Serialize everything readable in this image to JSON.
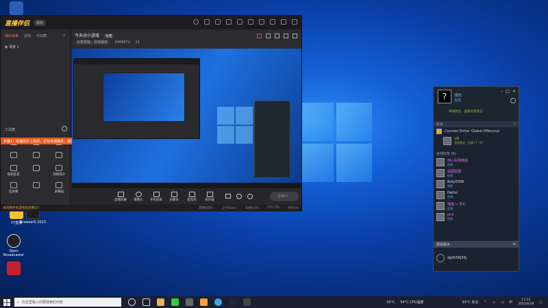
{
  "desktop": {
    "icons": [
      {
        "label": "YY直播",
        "color": "#f2c230"
      },
      {
        "label": "BrowserS 2023",
        "color": "#1e1e1e"
      },
      {
        "label": "Open Broadcaster",
        "color": "#222"
      },
      {
        "label": "",
        "color": "#c8202e"
      }
    ]
  },
  "app": {
    "brand": "直播伴侣",
    "version": "版权",
    "user_id": "6468872",
    "left_tabs": [
      "我的场景",
      "剪辑",
      "可收藏"
    ],
    "scene_label": "场景 1",
    "tools_title": "工具箱",
    "tools": [
      "",
      "",
      "",
      "",
      "",
      "",
      "",
      "",
      "",
      "",
      "",
      ""
    ],
    "tool_labels": [
      "",
      "",
      "",
      "",
      "",
      "",
      "视频连麦",
      "",
      "网络观众",
      "连屏幕",
      "",
      "屏幕画"
    ],
    "notice": "步骤1：将播助手上线即，达标专题播单，确认图调回调收益",
    "notice_close": "×",
    "preview_title": "今天对小游戏",
    "preview_badge": "标签",
    "preview_sub": "长按克隆：在线播放",
    "preview_id": "6468872",
    "preview_count": "12",
    "controls": [
      "直播屏幕",
      "摄像头",
      "手机投屏",
      "多媒体",
      "麦克风",
      "扬声器"
    ],
    "start_live": "直播中...",
    "status_tip": "如何把手机游戏投屏像头?",
    "status_stats": [
      "网络延迟0",
      "上行0kbps",
      "丢帧0.0%",
      "CPU 0%",
      "内存0%"
    ]
  },
  "steam": {
    "name": "海豹",
    "status": "在线",
    "game_text": "离线状态，查看好友状态",
    "sections": [
      "好友",
      "在线好友"
    ],
    "fav_game": "Counter-Strike: Global Offensive",
    "fav_player": "UN",
    "fav_sub": "竞技模式 - 比赛 [7 : 9]",
    "online_count": "在线好友 (6)",
    "friends": [
      {
        "name": "用心投降精版",
        "status": "在线"
      },
      {
        "name": "如图狐狸",
        "status": "在线"
      },
      {
        "name": "8sky0306",
        "status": "在线"
      },
      {
        "name": "Pakho",
        "status": "在线"
      },
      {
        "name": "喵喵 > 梦幻",
        "status": "在线"
      },
      {
        "name": "phe",
        "status": "在线"
      }
    ],
    "group_header": "群组聊天",
    "group_name": "dgSh56j56j"
  },
  "taskbar": {
    "search_placeholder": "在这里输入你要搜索的内容",
    "weather1": "33°C",
    "cpu": "54°C CPU温度",
    "weather2": "34°C 多云",
    "lang": "中",
    "time": "17:23",
    "date": "2022/6/18"
  },
  "colors": {
    "accent": "#ff6a3a",
    "steam_blue": "#6fb7e8",
    "notice": "#e85a1e"
  }
}
